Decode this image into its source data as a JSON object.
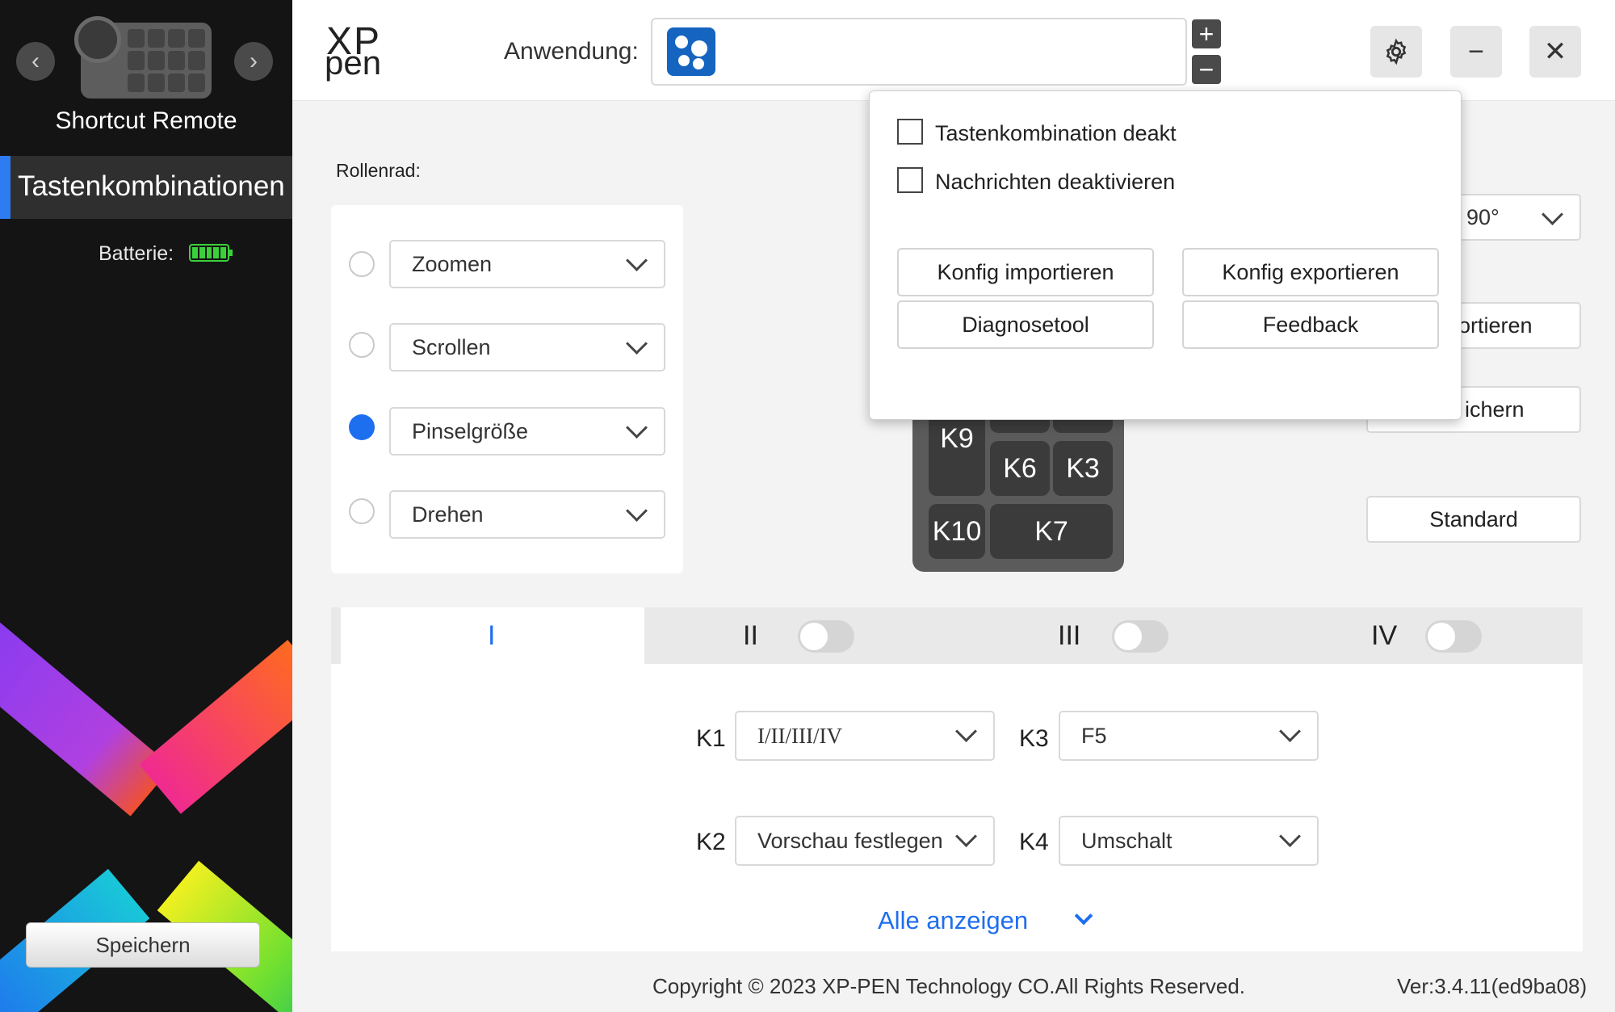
{
  "sidebar": {
    "device_name": "Shortcut Remote",
    "nav_active_label": "Tastenkombinationen",
    "battery_label": "Batterie:",
    "save_label": "Speichern",
    "prev_arrow": "‹",
    "next_arrow": "›"
  },
  "header": {
    "logo_top": "XP",
    "logo_bottom": "pen",
    "application_label": "Anwendung:",
    "add_symbol": "+",
    "remove_symbol": "−",
    "minimize_symbol": "−",
    "close_symbol": "✕"
  },
  "roller": {
    "label": "Rollenrad:",
    "options": [
      {
        "label": "Zoomen",
        "selected": false
      },
      {
        "label": "Scrollen",
        "selected": false
      },
      {
        "label": "Pinselgröße",
        "selected": true
      },
      {
        "label": "Drehen",
        "selected": false
      }
    ]
  },
  "keypad": {
    "keys": [
      "K9",
      "K6",
      "K3",
      "K10",
      "K7"
    ]
  },
  "right_panel": {
    "rotation_value": "90°",
    "import_partial": "ortieren",
    "save_partial": "ichern",
    "default_label": "Standard"
  },
  "popover": {
    "checkbox_1": "Tastenkombination deakt",
    "checkbox_2": "Nachrichten deaktivieren",
    "import_config": "Konfig importieren",
    "export_config": "Konfig exportieren",
    "diagnostic_tool": "Diagnosetool",
    "feedback": "Feedback"
  },
  "tabs": [
    {
      "label": "I",
      "active": true
    },
    {
      "label": "II",
      "enabled": false
    },
    {
      "label": "III",
      "enabled": false
    },
    {
      "label": "IV",
      "enabled": false
    }
  ],
  "keys": {
    "k1_label": "K1",
    "k1_value": "I/II/III/IV",
    "k2_label": "K2",
    "k2_value": "Vorschau festlegen",
    "k3_label": "K3",
    "k3_value": "F5",
    "k4_label": "K4",
    "k4_value": "Umschalt",
    "show_all": "Alle anzeigen"
  },
  "footer": {
    "copyright": "Copyright © 2023  XP-PEN Technology CO.All Rights Reserved.",
    "version": "Ver:3.4.11(ed9ba08)"
  },
  "colors": {
    "accent": "#1e6ef0",
    "sidebar_bg": "#141414",
    "battery": "#3ad13a"
  }
}
